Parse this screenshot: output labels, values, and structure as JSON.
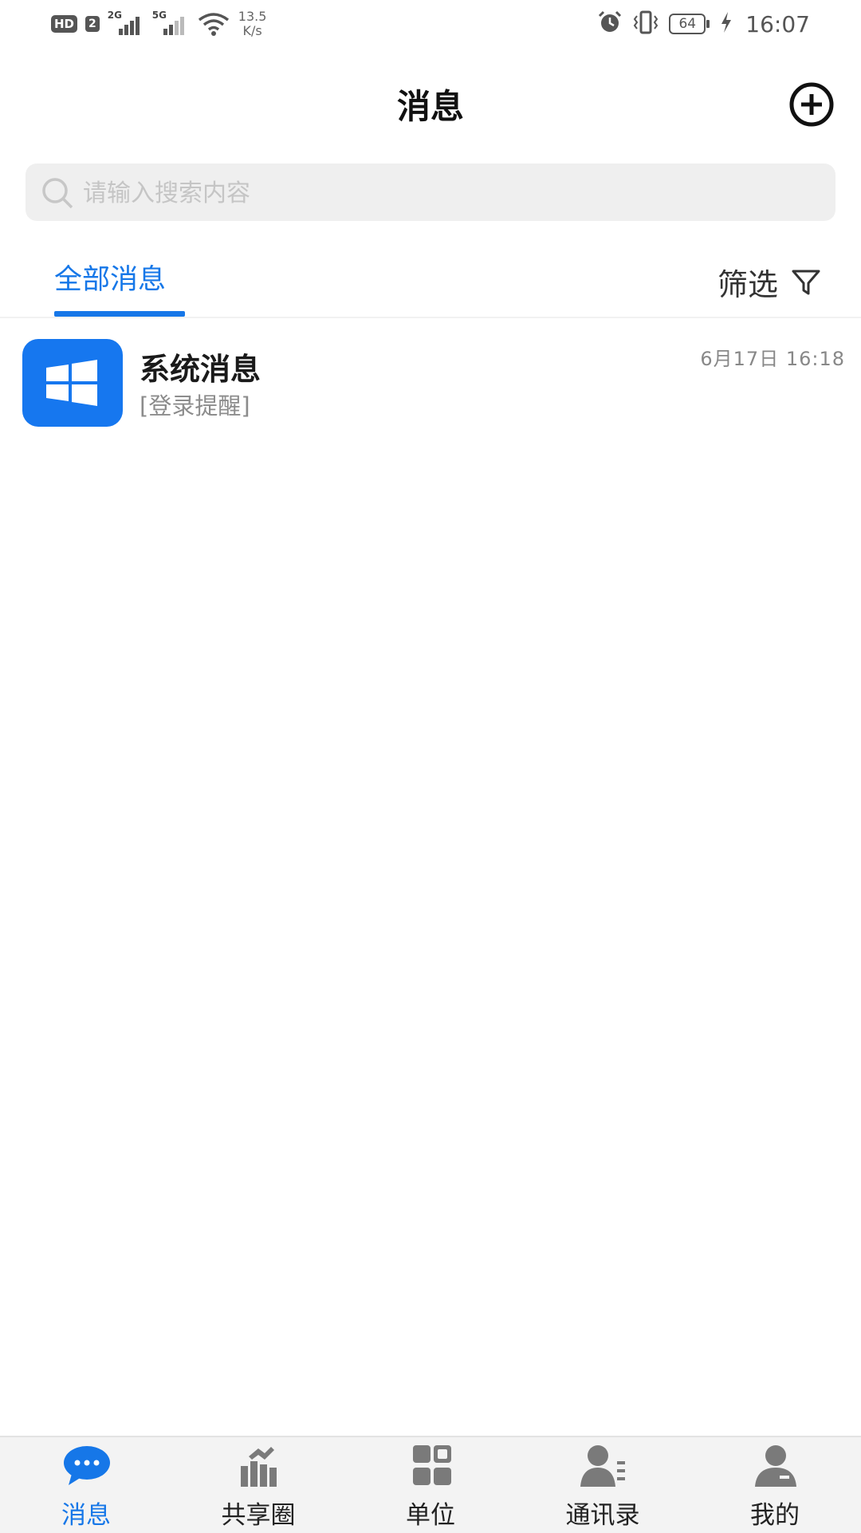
{
  "status_bar": {
    "hd": "HD",
    "sim": "2",
    "sig1": "2G",
    "sig2": "5G",
    "speed_value": "13.5",
    "speed_unit": "K/s",
    "battery": "64",
    "time": "16:07"
  },
  "header": {
    "title": "消息",
    "add_icon": "plus-circle-icon"
  },
  "search": {
    "placeholder": "请输入搜索内容",
    "value": ""
  },
  "tabs": {
    "active": "全部消息"
  },
  "filter": {
    "label": "筛选",
    "icon": "funnel-icon"
  },
  "messages": [
    {
      "title": "系统消息",
      "subtitle": "[登录提醒]",
      "time": "6月17日  16:18",
      "avatar_icon": "windows-logo-icon",
      "avatar_color": "#1677ef"
    }
  ],
  "bottom_nav": [
    {
      "label": "消息",
      "icon": "chat-bubble-icon",
      "active": true
    },
    {
      "label": "共享圈",
      "icon": "handshake-bars-icon",
      "active": false
    },
    {
      "label": "单位",
      "icon": "grid-apps-icon",
      "active": false
    },
    {
      "label": "通讯录",
      "icon": "contacts-icon",
      "active": false
    },
    {
      "label": "我的",
      "icon": "user-icon",
      "active": false
    }
  ],
  "colors": {
    "accent": "#1677e8",
    "inactive_icon": "#7a7a7a"
  }
}
